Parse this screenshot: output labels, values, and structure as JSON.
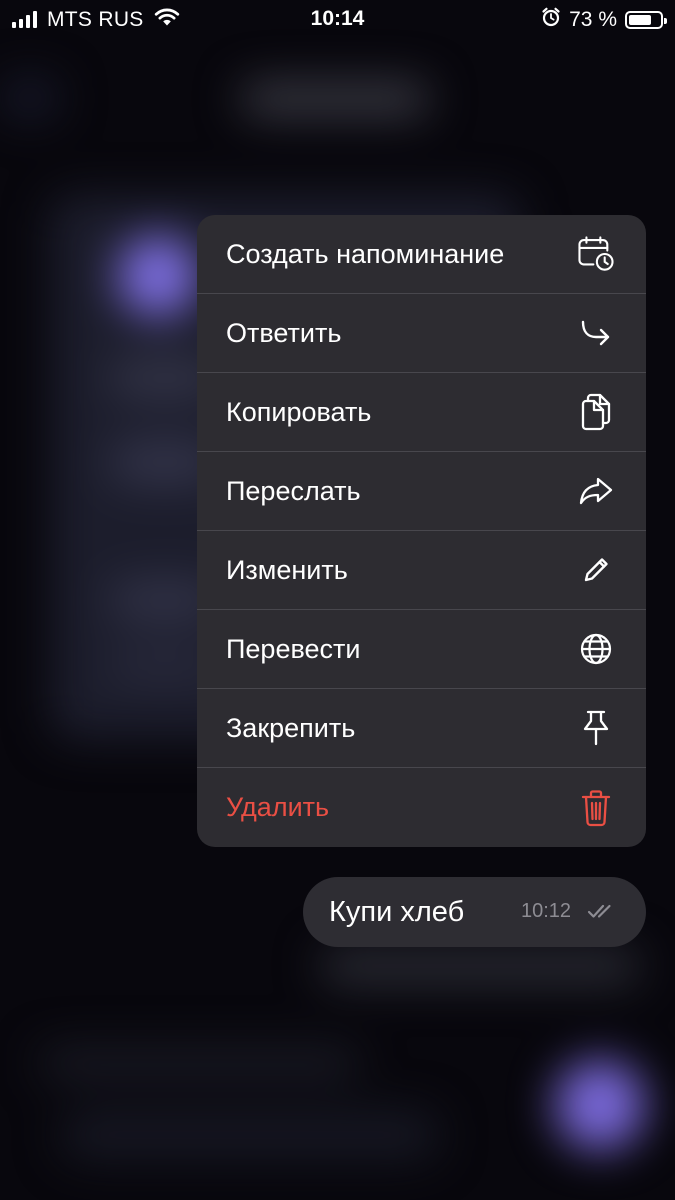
{
  "status_bar": {
    "carrier": "MTS RUS",
    "time": "10:14",
    "battery_percent": "73 %",
    "battery_level": 0.73,
    "icons": [
      "signal-bars-icon",
      "wifi-icon",
      "alarm-clock-icon",
      "battery-icon"
    ]
  },
  "context_menu": {
    "items": [
      {
        "label": "Создать напоминание",
        "icon": "calendar-clock-icon"
      },
      {
        "label": "Ответить",
        "icon": "reply-arrow-icon"
      },
      {
        "label": "Копировать",
        "icon": "copy-icon"
      },
      {
        "label": "Переслать",
        "icon": "forward-arrow-icon"
      },
      {
        "label": "Изменить",
        "icon": "pencil-icon"
      },
      {
        "label": "Перевести",
        "icon": "globe-icon"
      },
      {
        "label": "Закрепить",
        "icon": "pin-icon"
      },
      {
        "label": "Удалить",
        "icon": "trash-icon"
      }
    ],
    "colors": {
      "background": "#2d2c31",
      "text": "#ffffff",
      "danger": "#ea4f44"
    }
  },
  "message": {
    "text": "Купи хлеб",
    "time": "10:12",
    "status_icon": "double-check-icon"
  }
}
